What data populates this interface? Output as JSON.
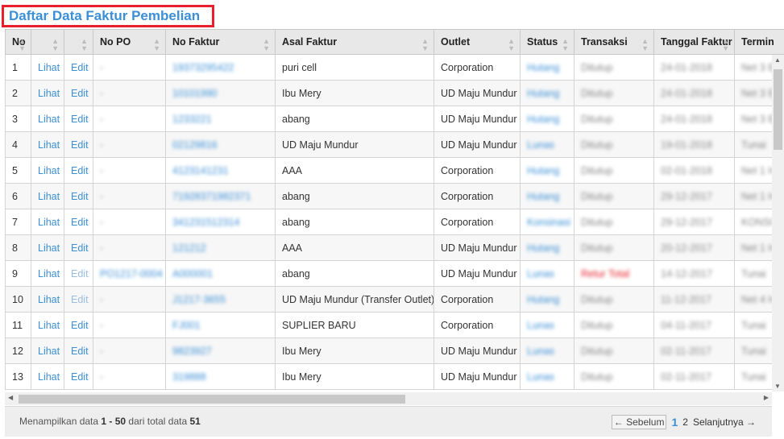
{
  "page": {
    "title": "Daftar Data Faktur Pembelian"
  },
  "columns": [
    "No",
    "",
    "",
    "No PO",
    "No Faktur",
    "Asal Faktur",
    "Outlet",
    "Status",
    "Transaksi",
    "Tanggal Faktur",
    "Termin"
  ],
  "rows": [
    {
      "no": "1",
      "lihat": "Lihat",
      "edit": "Edit",
      "po": "-",
      "faktur": "19373295422",
      "asal": "puri cell",
      "outlet": "Corporation",
      "status": "Hutang",
      "transaksi": "Ditutup",
      "tanggal": "24-01-2018",
      "termin": "Net 3 E"
    },
    {
      "no": "2",
      "lihat": "Lihat",
      "edit": "Edit",
      "po": "-",
      "faktur": "10101990",
      "asal": "Ibu Mery",
      "outlet": "UD Maju Mundur",
      "status": "Hutang",
      "transaksi": "Ditutup",
      "tanggal": "24-01-2018",
      "termin": "Net 3 E"
    },
    {
      "no": "3",
      "lihat": "Lihat",
      "edit": "Edit",
      "po": "-",
      "faktur": "1233221",
      "asal": "abang",
      "outlet": "UD Maju Mundur",
      "status": "Hutang",
      "transaksi": "Ditutup",
      "tanggal": "24-01-2018",
      "termin": "Net 3 E"
    },
    {
      "no": "4",
      "lihat": "Lihat",
      "edit": "Edit",
      "po": "-",
      "faktur": "02129816",
      "asal": "UD Maju Mundur",
      "outlet": "UD Maju Mundur",
      "status": "Lunas",
      "transaksi": "Ditutup",
      "tanggal": "19-01-2018",
      "termin": "Tunai"
    },
    {
      "no": "5",
      "lihat": "Lihat",
      "edit": "Edit",
      "po": "-",
      "faktur": "4123141231",
      "asal": "AAA",
      "outlet": "Corporation",
      "status": "Hutang",
      "transaksi": "Ditutup",
      "tanggal": "02-01-2018",
      "termin": "Net 1 H"
    },
    {
      "no": "6",
      "lihat": "Lihat",
      "edit": "Edit",
      "po": "-",
      "faktur": "71928371982371",
      "asal": "abang",
      "outlet": "Corporation",
      "status": "Hutang",
      "transaksi": "Ditutup",
      "tanggal": "29-12-2017",
      "termin": "Net 1 H"
    },
    {
      "no": "7",
      "lihat": "Lihat",
      "edit": "Edit",
      "po": "-",
      "faktur": "341231512314",
      "asal": "abang",
      "outlet": "Corporation",
      "status": "Konsinasi",
      "transaksi": "Ditutup",
      "tanggal": "29-12-2017",
      "termin": "KONSI"
    },
    {
      "no": "8",
      "lihat": "Lihat",
      "edit": "Edit",
      "po": "-",
      "faktur": "121212",
      "asal": "AAA",
      "outlet": "UD Maju Mundur",
      "status": "Hutang",
      "transaksi": "Ditutup",
      "tanggal": "20-12-2017",
      "termin": "Net 1 H"
    },
    {
      "no": "9",
      "lihat": "Lihat",
      "edit": "Edit",
      "po": "PO1217-0004",
      "faktur": "A000001",
      "asal": "abang",
      "outlet": "UD Maju Mundur",
      "status": "Lunas",
      "transaksi": "Retur Total",
      "tanggal": "14-12-2017",
      "termin": "Tunai",
      "edit_disabled": true,
      "transaksi_red": true
    },
    {
      "no": "10",
      "lihat": "Lihat",
      "edit": "Edit",
      "po": "-",
      "faktur": "J1217-3655",
      "asal": "UD Maju Mundur (Transfer Outlet)",
      "outlet": "Corporation",
      "status": "Hutang",
      "transaksi": "Ditutup",
      "tanggal": "11-12-2017",
      "termin": "Net 4 H",
      "edit_disabled": true
    },
    {
      "no": "11",
      "lihat": "Lihat",
      "edit": "Edit",
      "po": "-",
      "faktur": "FJ001",
      "asal": "SUPLIER BARU",
      "outlet": "Corporation",
      "status": "Lunas",
      "transaksi": "Ditutup",
      "tanggal": "04-11-2017",
      "termin": "Tunai"
    },
    {
      "no": "12",
      "lihat": "Lihat",
      "edit": "Edit",
      "po": "-",
      "faktur": "9823927",
      "asal": "Ibu Mery",
      "outlet": "UD Maju Mundur",
      "status": "Lunas",
      "transaksi": "Ditutup",
      "tanggal": "02-11-2017",
      "termin": "Tunai"
    },
    {
      "no": "13",
      "lihat": "Lihat",
      "edit": "Edit",
      "po": "-",
      "faktur": "319888",
      "asal": "Ibu Mery",
      "outlet": "UD Maju Mundur",
      "status": "Lunas",
      "transaksi": "Ditutup",
      "tanggal": "02-11-2017",
      "termin": "Tunai"
    }
  ],
  "footer": {
    "info_prefix": "Menampilkan data ",
    "info_range": "1 - 50",
    "info_mid": " dari total data ",
    "info_total": "51",
    "prev_label": "← Sebelum",
    "pages": [
      "1",
      "2"
    ],
    "current_page": "1",
    "next_label": "Selanjutnya →"
  },
  "colors": {
    "accent": "#3a8fd6",
    "title_border": "#e8202a",
    "header_bg": "#e8e8e8"
  }
}
